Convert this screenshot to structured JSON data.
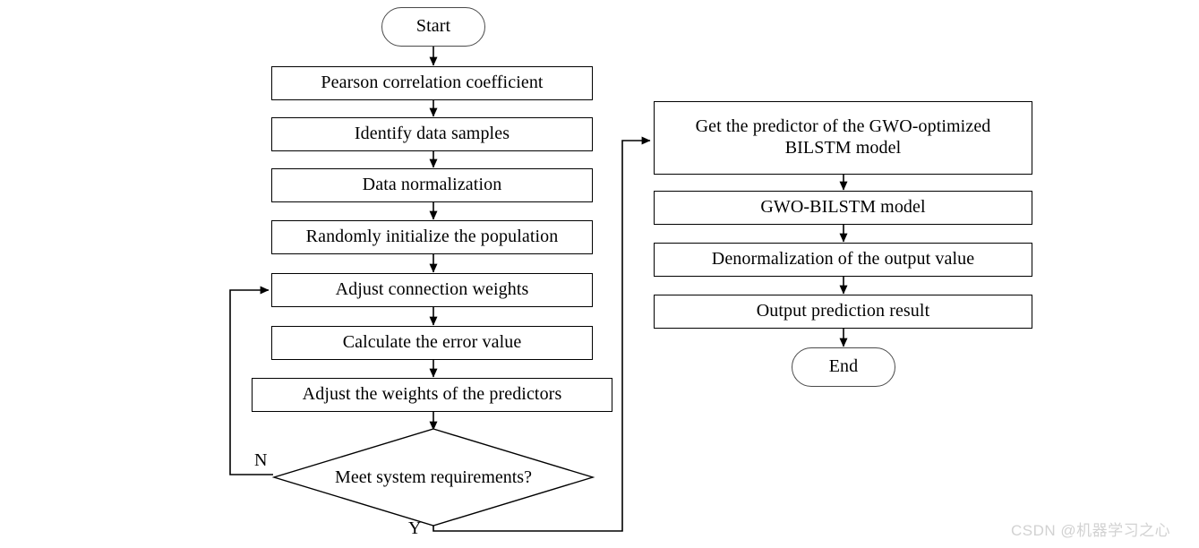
{
  "diagram": {
    "title": "GWO-BILSTM prediction model flowchart",
    "colors": {
      "line": "#000000",
      "box_border": "#000000",
      "terminator_border": "#4a4a4a",
      "background": "#ffffff",
      "text": "#000000",
      "watermark": "#d2d2d2"
    },
    "nodes": {
      "start": "Start",
      "pearson": "Pearson correlation coefficient",
      "identify": "Identify data samples",
      "normalize": "Data normalization",
      "init_population": "Randomly initialize the population",
      "adjust_connection": "Adjust connection weights",
      "calc_error": "Calculate the error value",
      "adjust_predictors": "Adjust the weights of the predictors",
      "decision": "Meet system requirements?",
      "get_predictor": "Get the predictor of the GWO-optimized BILSTM model",
      "gwo_bilstm": "GWO-BILSTM model",
      "denormalize": "Denormalization of the output value",
      "output": "Output prediction result",
      "end": "End"
    },
    "edge_labels": {
      "no": "N",
      "yes": "Y"
    }
  },
  "watermark": {
    "text": "CSDN @机器学习之心"
  }
}
